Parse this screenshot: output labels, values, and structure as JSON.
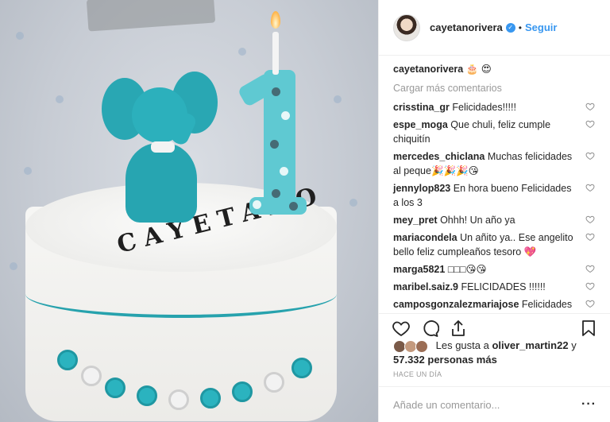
{
  "header": {
    "username": "cayetanorivera",
    "verified_mark": "✓",
    "separator": "•",
    "follow_label": "Seguir"
  },
  "photo": {
    "cake_name": "CAYETANO",
    "candle_number": "1"
  },
  "caption": {
    "username": "cayetanorivera",
    "text": "🎂 😍"
  },
  "load_more_label": "Cargar más comentarios",
  "comments": [
    {
      "user": "crisstina_gr",
      "text": "Felicidades!!!!!"
    },
    {
      "user": "espe_moga",
      "text": "Que chuli, feliz cumple chiquitín"
    },
    {
      "user": "mercedes_chiclana",
      "text": "Muchas felicidades al peque🎉🎉🎉😘"
    },
    {
      "user": "jennylop823",
      "text": "En hora bueno Felicidades a los 3"
    },
    {
      "user": "mey_pret",
      "text": "Ohhh! Un año ya"
    },
    {
      "user": "mariacondela",
      "text": "Un añito ya.. Ese angelito bello feliz cumpleaños tesoro 💖"
    },
    {
      "user": "marga5821",
      "text": "□□□😘😘"
    },
    {
      "user": "maribel.saiz.9",
      "text": "FELICIDADES !!!!!!"
    },
    {
      "user": "camposgonzalezmariajose",
      "text": "Felicidades al muñeco de la casa 💖💖💖💖"
    }
  ],
  "likes": {
    "prefix": "Les gusta a",
    "user": "oliver_martin22",
    "connector": "y",
    "count": "57.332 personas más"
  },
  "timestamp": "HACE UN DÍA",
  "add_comment": {
    "placeholder": "Añade un comentario...",
    "more_label": "···"
  },
  "colors": {
    "link_blue": "#3897f0",
    "text": "#262626",
    "muted": "#999999",
    "cake_teal": "#2cb0bc"
  },
  "icons": [
    "heart-icon",
    "comment-icon",
    "share-icon",
    "bookmark-icon",
    "verified-badge-icon",
    "avatar",
    "small-heart-icon"
  ]
}
